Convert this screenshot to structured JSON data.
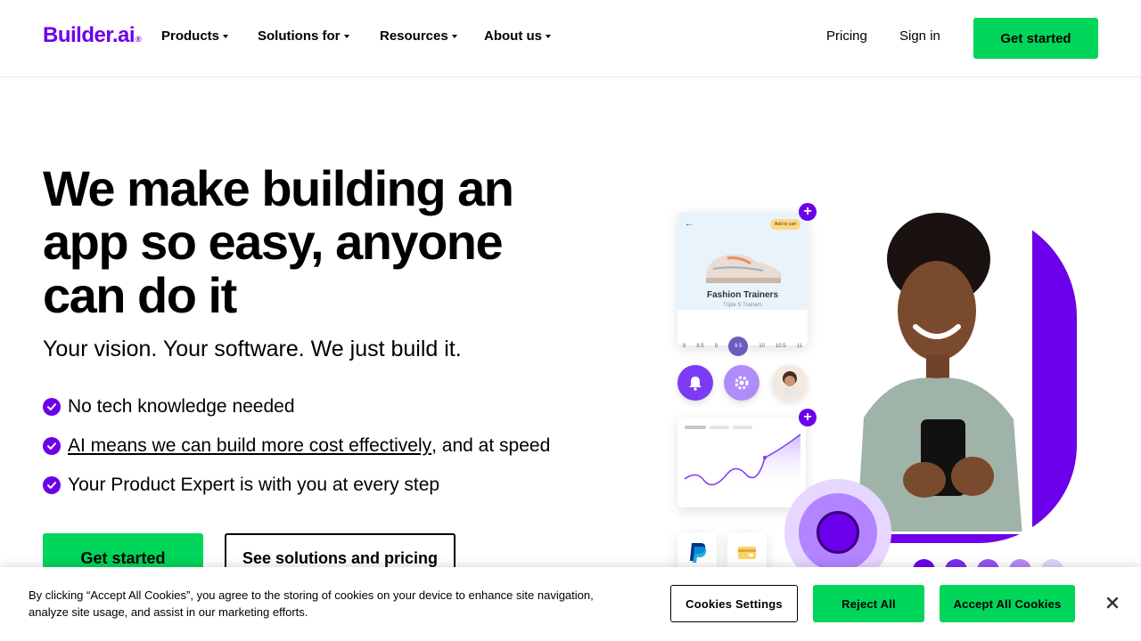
{
  "header": {
    "logo_text": "Builder.ai",
    "logo_mark": "®",
    "nav": [
      {
        "label": "Products"
      },
      {
        "label": "Solutions for"
      },
      {
        "label": "Resources"
      },
      {
        "label": "About us"
      }
    ],
    "pricing": "Pricing",
    "signin": "Sign in",
    "cta": "Get started"
  },
  "hero": {
    "title": "We make building an app so easy, anyone can do it",
    "subtitle": "Your vision. Your software. We just build it.",
    "bullets": [
      {
        "text": "No tech knowledge needed"
      },
      {
        "link": "AI means we can build more cost effectively",
        "text": ", and at speed"
      },
      {
        "text": "Your Product Expert is with you at every step"
      }
    ],
    "primary_cta": "Get started",
    "secondary_cta": "See solutions and pricing"
  },
  "illustration": {
    "card_title": "Fashion Trainers",
    "card_subtitle": "Triple S Trainers",
    "badge": "Add to cart",
    "sizes": [
      "8",
      "8.5",
      "9",
      "9.5",
      "10",
      "10.5",
      "11"
    ],
    "selected_size": "9.5"
  },
  "cookie": {
    "text": "By clicking “Accept All Cookies”, you agree to the storing of cookies on your device to enhance site navigation, analyze site usage, and assist in our marketing efforts.",
    "settings": "Cookies Settings",
    "reject": "Reject All",
    "accept": "Accept All Cookies"
  },
  "colors": {
    "brand_purple": "#6c00ea",
    "cta_green": "#00d659"
  }
}
